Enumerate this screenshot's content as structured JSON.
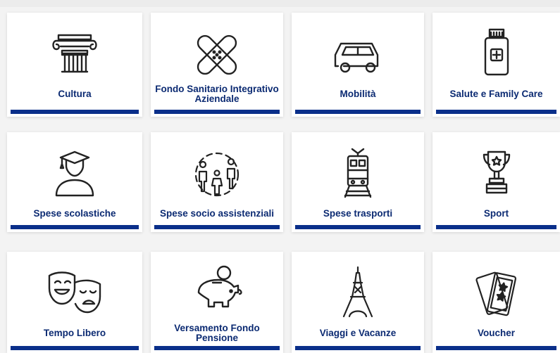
{
  "tiles": [
    {
      "label": "Cultura",
      "icon": "column-icon"
    },
    {
      "label": "Fondo Sanitario Integrativo Aziendale",
      "icon": "bandage-icon"
    },
    {
      "label": "Mobilità",
      "icon": "car-icon"
    },
    {
      "label": "Salute e Family Care",
      "icon": "medicine-bottle-icon"
    },
    {
      "label": "Spese scolastiche",
      "icon": "graduate-icon"
    },
    {
      "label": "Spese socio assistenziali",
      "icon": "family-icon"
    },
    {
      "label": "Spese trasporti",
      "icon": "train-icon"
    },
    {
      "label": "Sport",
      "icon": "trophy-icon"
    },
    {
      "label": "Tempo Libero",
      "icon": "theater-masks-icon"
    },
    {
      "label": "Versamento Fondo Pensione",
      "icon": "piggy-bank-icon"
    },
    {
      "label": "Viaggi e Vacanze",
      "icon": "eiffel-tower-icon"
    },
    {
      "label": "Voucher",
      "icon": "ticket-icon"
    }
  ],
  "colors": {
    "accent": "#0a2f8a",
    "label": "#0b2a72",
    "icon_stroke": "#222222"
  }
}
